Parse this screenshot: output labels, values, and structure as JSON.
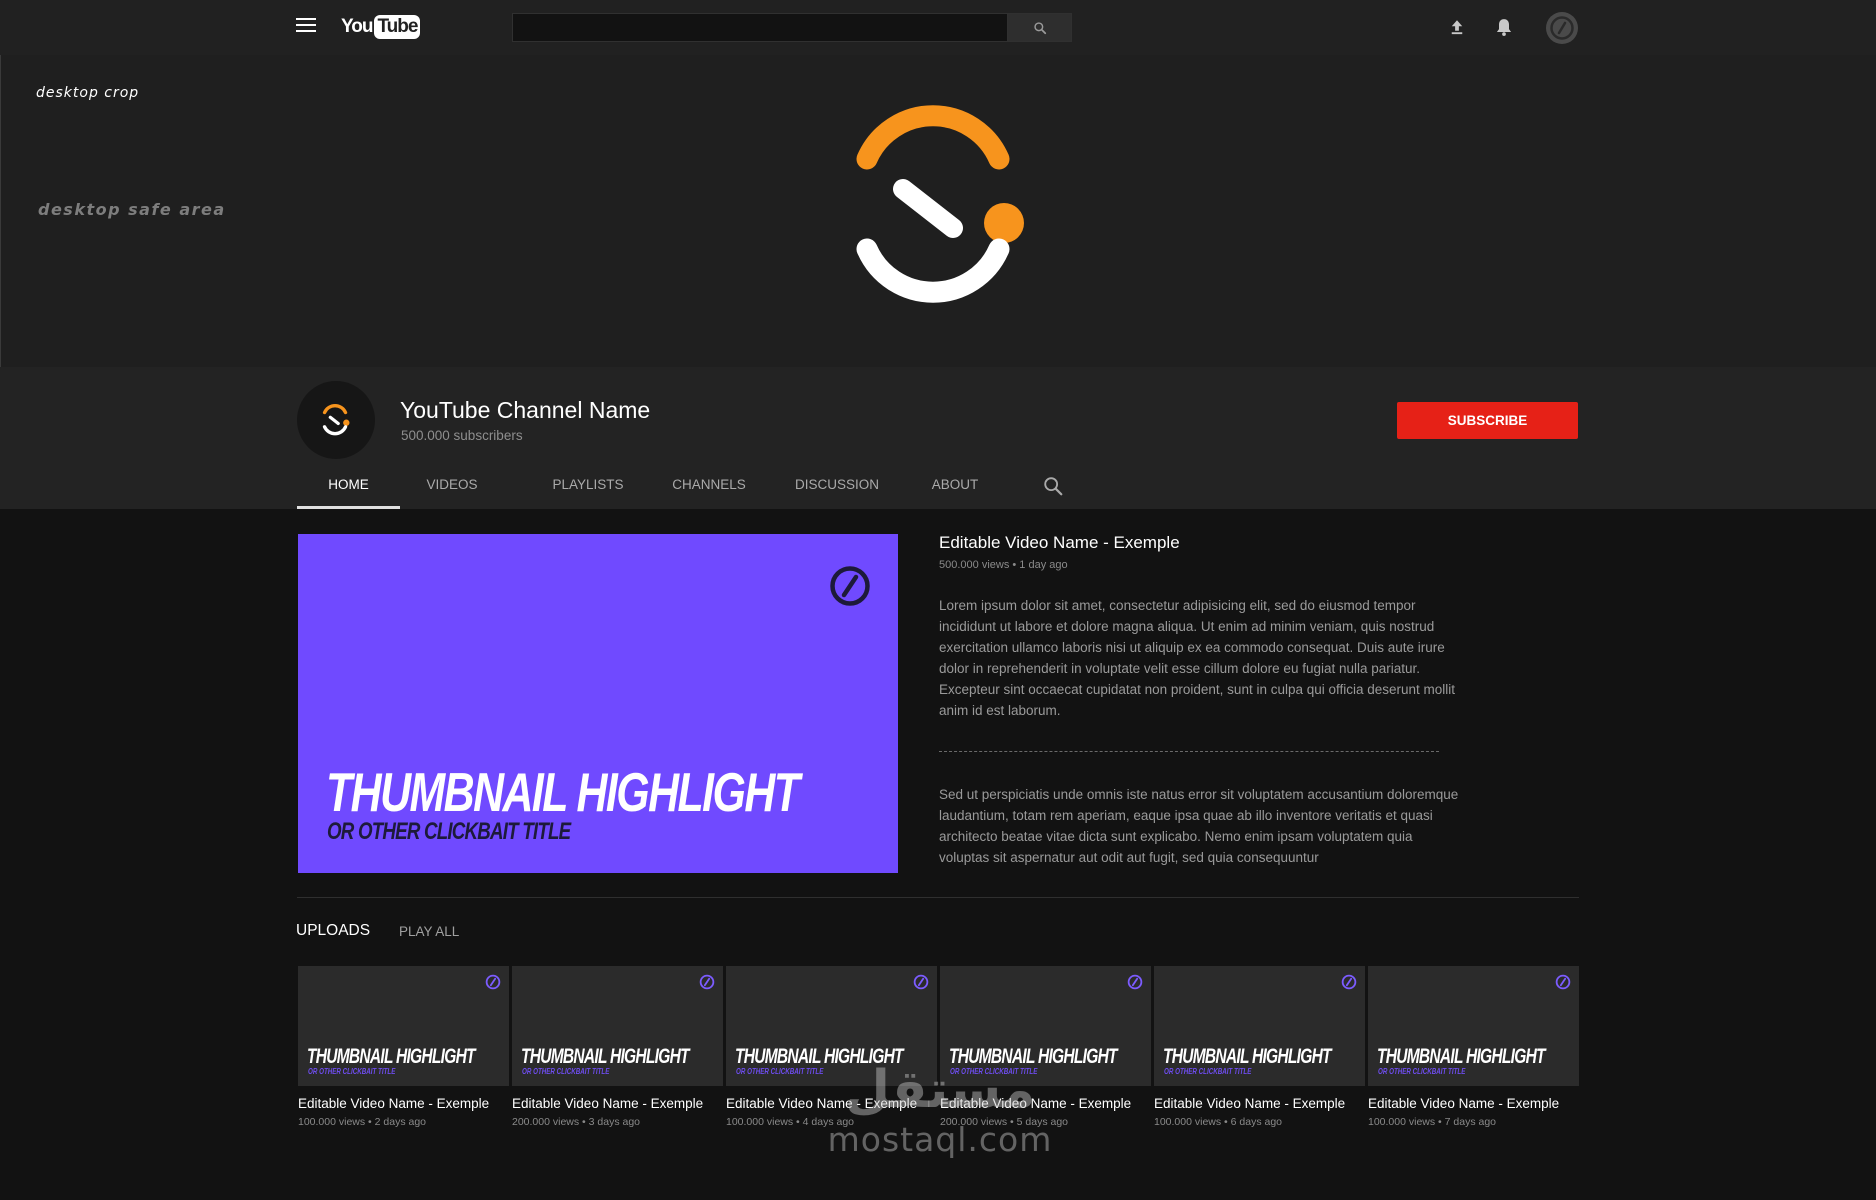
{
  "topbar": {
    "logo_you": "You",
    "logo_tube": "Tube",
    "search": {
      "placeholder": ""
    }
  },
  "banner": {
    "crop_label": "desktop crop",
    "safe_label": "desktop safe area"
  },
  "colors": {
    "brand_orange": "#f7941d",
    "subscribe_red": "#e62117",
    "thumb_purple": "#704aff"
  },
  "channel": {
    "name": "YouTube Channel Name",
    "subscribers": "500.000 subscribers",
    "subscribe_label": "SUBSCRIBE"
  },
  "tabs": [
    {
      "label": "HOME",
      "active": true
    },
    {
      "label": "VIDEOS",
      "active": false
    },
    {
      "label": "PLAYLISTS",
      "active": false
    },
    {
      "label": "CHANNELS",
      "active": false
    },
    {
      "label": "DISCUSSION",
      "active": false
    },
    {
      "label": "ABOUT",
      "active": false
    }
  ],
  "featured": {
    "thumb_title": "THUMBNAIL HIGHLIGHT",
    "thumb_subtitle": "OR OTHER CLICKBAIT TITLE",
    "title": "Editable Video Name - Exemple",
    "meta": "500.000 views • 1 day ago",
    "description": "Lorem ipsum dolor sit amet, consectetur adipisicing elit, sed do eiusmod tempor incididunt ut labore et dolore magna aliqua. Ut enim ad minim veniam, quis nostrud exercitation ullamco laboris nisi ut aliquip ex ea commodo consequat. Duis aute irure dolor in reprehenderit in voluptate velit esse cillum dolore eu fugiat nulla pariatur. Excepteur sint occaecat cupidatat non proident, sunt in culpa qui officia deserunt mollit anim id est laborum.",
    "description_2": "Sed ut perspiciatis unde omnis iste natus error sit voluptatem accusantium doloremque laudantium, totam rem aperiam, eaque ipsa quae ab illo inventore veritatis et quasi architecto beatae vitae dicta sunt explicabo. Nemo enim ipsam voluptatem quia voluptas sit aspernatur aut odit aut fugit, sed quia consequuntur"
  },
  "uploads": {
    "title": "UPLOADS",
    "play_all": "PLAY ALL",
    "videos": [
      {
        "thumb_title": "THUMBNAIL HIGHLIGHT",
        "thumb_subtitle": "OR OTHER CLICKBAIT TITLE",
        "title": "Editable Video Name - Exemple",
        "meta": "100.000 views • 2 days ago"
      },
      {
        "thumb_title": "THUMBNAIL HIGHLIGHT",
        "thumb_subtitle": "OR OTHER CLICKBAIT TITLE",
        "title": "Editable Video Name - Exemple",
        "meta": "200.000 views • 3 days ago"
      },
      {
        "thumb_title": "THUMBNAIL HIGHLIGHT",
        "thumb_subtitle": "OR OTHER CLICKBAIT TITLE",
        "title": "Editable Video Name - Exemple",
        "meta": "100.000 views • 4 days ago"
      },
      {
        "thumb_title": "THUMBNAIL HIGHLIGHT",
        "thumb_subtitle": "OR OTHER CLICKBAIT TITLE",
        "title": "Editable Video Name - Exemple",
        "meta": "200.000 views • 5 days ago"
      },
      {
        "thumb_title": "THUMBNAIL HIGHLIGHT",
        "thumb_subtitle": "OR OTHER CLICKBAIT TITLE",
        "title": "Editable Video Name - Exemple",
        "meta": "100.000 views • 6 days ago"
      },
      {
        "thumb_title": "THUMBNAIL HIGHLIGHT",
        "thumb_subtitle": "OR OTHER CLICKBAIT TITLE",
        "title": "Editable Video Name - Exemple",
        "meta": "100.000 views • 7 days ago"
      }
    ]
  },
  "watermark": {
    "arabic": "مستقل",
    "url": "mostaql.com"
  }
}
